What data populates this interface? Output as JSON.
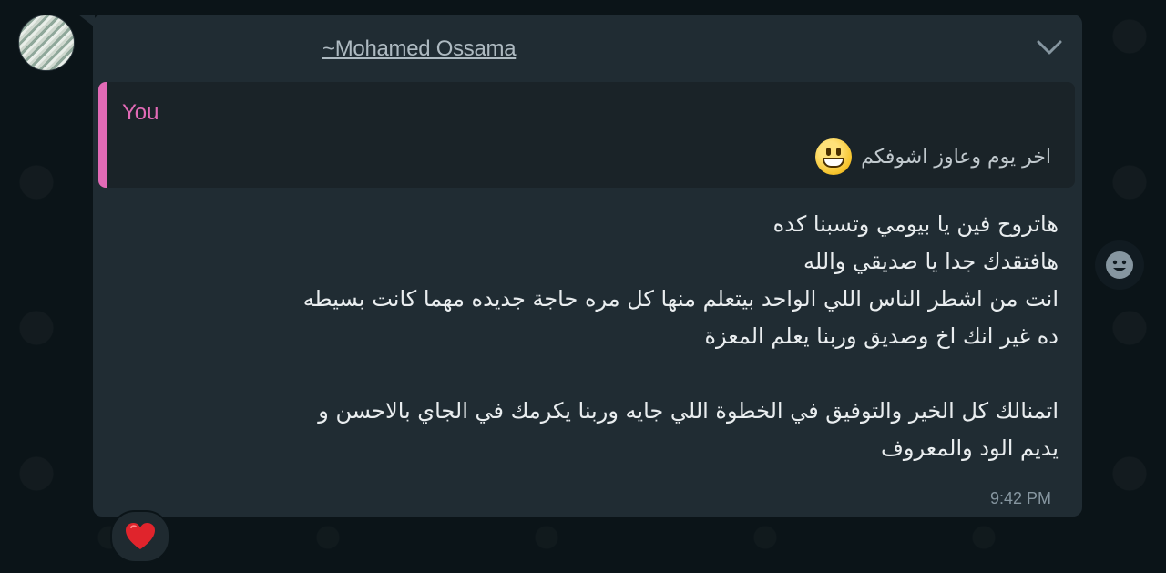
{
  "sender": {
    "name": "~Mohamed Ossama"
  },
  "quote": {
    "author": "You",
    "text": "اخر يوم وعاوز اشوفكم",
    "emoji": "smiling-face-icon",
    "bar_color": "#e26ab6"
  },
  "message": {
    "lines": [
      "هاتروح فين يا بيومي وتسبنا كده",
      "هافتقدك جدا يا صديقي  والله",
      "انت من اشطر الناس اللي الواحد بيتعلم منها كل مره حاجة جديده مهما كانت بسيطه",
      "ده غير انك اخ وصديق وربنا يعلم المعزة",
      "",
      "اتمنالك كل الخير والتوفيق في الخطوة اللي جايه وربنا يكرمك في الجاي بالاحسن و",
      "يديم الود والمعروف"
    ],
    "time": "9:42 PM"
  },
  "reaction": {
    "emoji": "red-heart-icon"
  },
  "icons": {
    "menu": "chevron-down-icon",
    "react": "emoji-icon"
  },
  "colors": {
    "bubble": "#202c33",
    "background": "#0b1418",
    "text": "#e9edef",
    "muted": "#8696a0"
  }
}
